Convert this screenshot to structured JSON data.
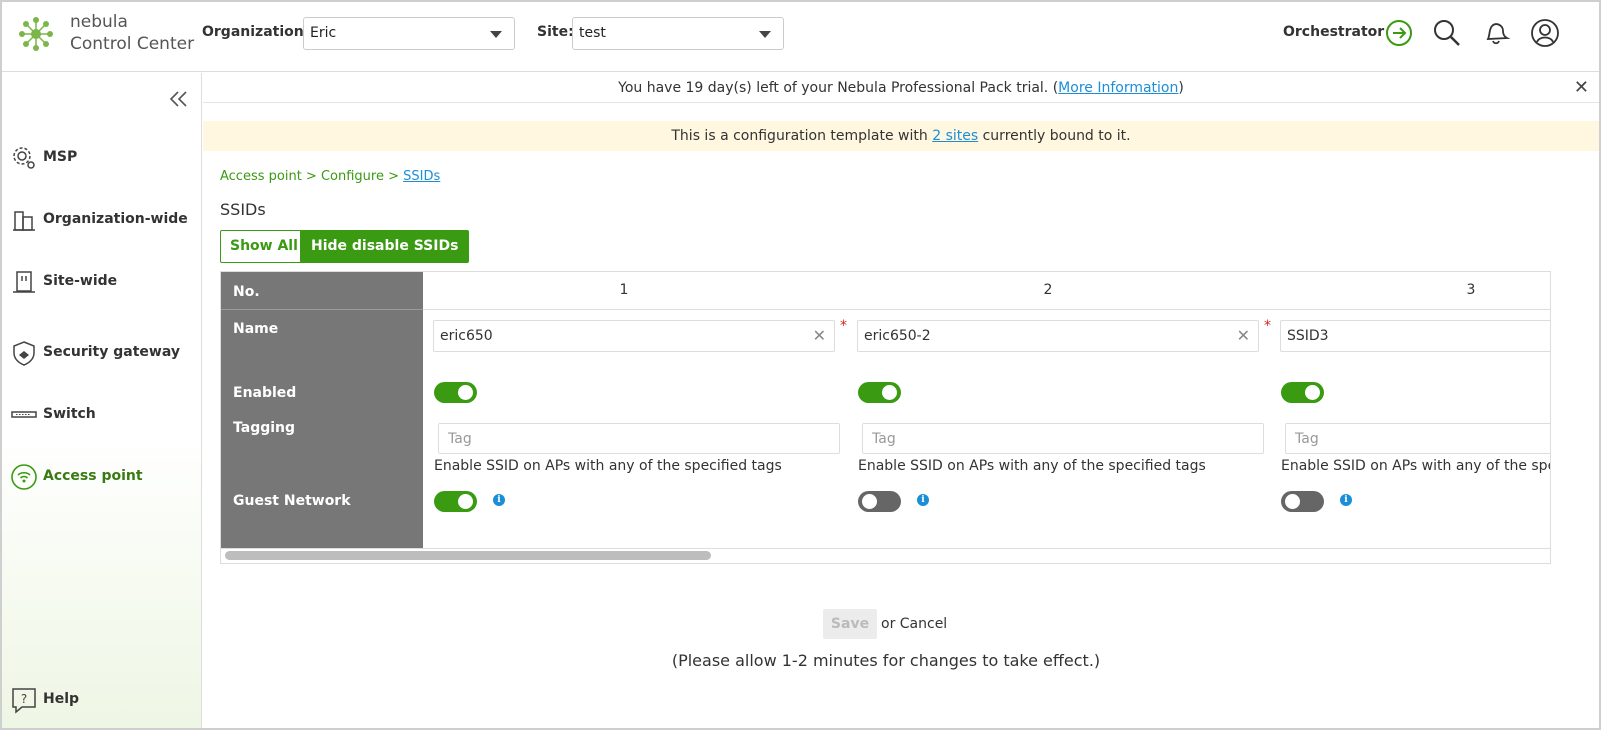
{
  "brand": {
    "line1": "nebula",
    "line2": "Control Center"
  },
  "header": {
    "org_label": "Organization:",
    "org_value": "Eric",
    "site_label": "Site:",
    "site_value": "test",
    "orchestrator_label": "Orchestrator"
  },
  "sidebar": {
    "items": [
      {
        "label": "MSP",
        "icon": "msp-gear-icon"
      },
      {
        "label": "Organization-wide",
        "icon": "building-icon"
      },
      {
        "label": "Site-wide",
        "icon": "site-icon"
      },
      {
        "label": "Security gateway",
        "icon": "shield-icon"
      },
      {
        "label": "Switch",
        "icon": "switch-icon"
      },
      {
        "label": "Access point",
        "icon": "wifi-icon",
        "active": true
      },
      {
        "label": "Help",
        "icon": "help-icon"
      }
    ]
  },
  "trial": {
    "prefix": "You have 19 day(s) left of your Nebula Professional Pack trial. (",
    "link": "More Information",
    "suffix": ")"
  },
  "banner": {
    "prefix": "This is a configuration template with ",
    "link": "2 sites",
    "suffix": " currently bound to it."
  },
  "breadcrumb": {
    "part1": "Access point",
    "part2": "Configure",
    "current": "SSIDs",
    "sep": " > "
  },
  "page_title": "SSIDs",
  "buttons": {
    "show_all": "Show All",
    "hide_disabled": "Hide disable SSIDs"
  },
  "table": {
    "row_headers": {
      "no": "No.",
      "name": "Name",
      "enabled": "Enabled",
      "tagging": "Tagging",
      "guest": "Guest Network"
    },
    "tag_placeholder": "Tag",
    "tag_hint": "Enable SSID on APs with any of the specified tags",
    "columns": [
      {
        "number": "1",
        "name": "eric650",
        "enabled": true,
        "guest": true,
        "clearable": true,
        "required": true
      },
      {
        "number": "2",
        "name": "eric650-2",
        "enabled": true,
        "guest": false,
        "clearable": true,
        "required": true
      },
      {
        "number": "3",
        "name": "SSID3",
        "enabled": true,
        "guest": false,
        "clearable": false,
        "required": false
      }
    ]
  },
  "footer": {
    "save": "Save",
    "or_cancel": "or Cancel",
    "note": "(Please allow 1-2 minutes for changes to take effect.)"
  },
  "colors": {
    "accent": "#3a9a12",
    "link": "#1a8fd8",
    "banner_bg": "#fff7e0",
    "row_header_bg": "#777777"
  }
}
